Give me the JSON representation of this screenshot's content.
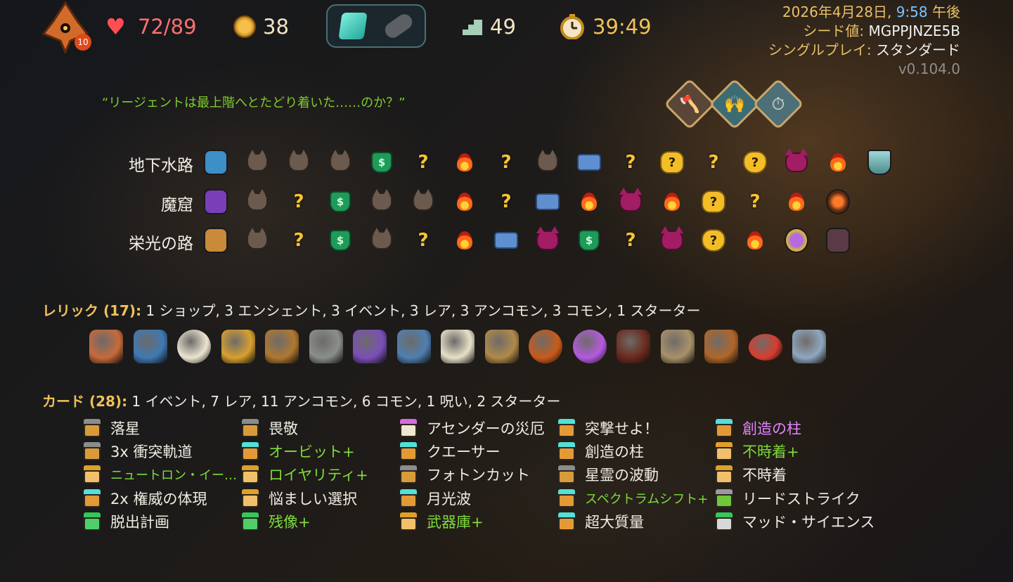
{
  "hud": {
    "hp": "72/89",
    "gold": "38",
    "floor": "49",
    "timer": "39:49",
    "ascension": "10"
  },
  "meta": {
    "date": "2026年4月28日, ",
    "time": "9:58",
    "ampm": " 午後",
    "seed_label": "シード値: ",
    "seed": "MGPPJNZE5B",
    "mode_label": "シングルプレイ: ",
    "mode": "スタンダード",
    "version": "v0.104.0"
  },
  "quote": "“リージェントは最上階へとたどり着いた……のか？”",
  "acts": [
    {
      "name": "地下水路",
      "nodes": [
        "boss-blue",
        "monster",
        "monster",
        "monster",
        "treasure-bag",
        "unknown",
        "rest",
        "unknown",
        "monster",
        "chest",
        "unknown",
        "rare-unknown",
        "unknown",
        "elite-unknown",
        "elite",
        "rest",
        "boss-end"
      ]
    },
    {
      "name": "魔窟",
      "nodes": [
        "boss-purple",
        "monster",
        "unknown",
        "treasure-bag",
        "monster",
        "monster",
        "rest",
        "unknown",
        "chest",
        "rest",
        "elite",
        "rest",
        "rare-unknown",
        "unknown",
        "rest",
        "boss-end2"
      ]
    },
    {
      "name": "栄光の路",
      "nodes": [
        "boss-lion",
        "monster",
        "unknown",
        "treasure-bag",
        "monster",
        "unknown",
        "rest",
        "chest",
        "elite",
        "treasure-bag",
        "unknown",
        "elite",
        "elite-unknown",
        "rest",
        "boss-gem",
        "boss-end3"
      ]
    }
  ],
  "relics": {
    "label": "レリック (17):",
    "summary": " 1 ショップ,  3 エンシェント,  3 イベント,  3 レア,  3 アンコモン,  3 コモン,  1 スターター",
    "items": [
      "ore-relic",
      "chest-relic",
      "cheese-relic",
      "flower-pot-relic",
      "horse-relic",
      "candelabra-relic",
      "tent-relic",
      "anvil-relic",
      "duck-relic",
      "lantern-relic",
      "yarn-relic",
      "orb-relic",
      "crossbow-relic",
      "backpack-relic",
      "crate-relic",
      "button-relic",
      "drill-relic"
    ]
  },
  "cards": {
    "label": "カード (28):",
    "summary": " 1 イベント,  7 レア,  11 アンコモン,  6 コモン,  1 呪い,  2 スターター",
    "columns": [
      [
        {
          "name": "落星",
          "icon": "gray",
          "color": "white"
        },
        {
          "name": "3x 衝突軌道",
          "icon": "gray",
          "color": "white"
        },
        {
          "name": "ニュートロン・イー…",
          "icon": "gold",
          "color": "green"
        },
        {
          "name": "2x 権威の体現",
          "icon": "teal",
          "color": "white"
        },
        {
          "name": "脱出計画",
          "icon": "green",
          "color": "white"
        }
      ],
      [
        {
          "name": "畏敬",
          "icon": "gray",
          "color": "white"
        },
        {
          "name": "オービット+",
          "icon": "teal",
          "color": "green"
        },
        {
          "name": "ロイヤリティ+",
          "icon": "gold",
          "color": "green"
        },
        {
          "name": "悩ましい選択",
          "icon": "gold",
          "color": "white"
        },
        {
          "name": "残像+",
          "icon": "green",
          "color": "green"
        }
      ],
      [
        {
          "name": "アセンダーの災厄",
          "icon": "pink",
          "color": "white"
        },
        {
          "name": "クエーサー",
          "icon": "teal",
          "color": "white"
        },
        {
          "name": "フォトンカット",
          "icon": "gray",
          "color": "white"
        },
        {
          "name": "月光波",
          "icon": "teal",
          "color": "white"
        },
        {
          "name": "武器庫+",
          "icon": "gold",
          "color": "green"
        }
      ],
      [
        {
          "name": "突撃せよ！",
          "icon": "teal",
          "color": "white"
        },
        {
          "name": "創造の柱",
          "icon": "teal",
          "color": "white"
        },
        {
          "name": "星霊の波動",
          "icon": "gray",
          "color": "white"
        },
        {
          "name": "スペクトラムシフト+",
          "icon": "teal",
          "color": "green"
        },
        {
          "name": "超大質量",
          "icon": "teal",
          "color": "white"
        }
      ],
      [
        {
          "name": "創造の柱",
          "icon": "teal",
          "color": "purple"
        },
        {
          "name": "不時着+",
          "icon": "gold",
          "color": "green"
        },
        {
          "name": "不時着",
          "icon": "gold",
          "color": "white"
        },
        {
          "name": "リードストライク",
          "icon": "gray-green",
          "color": "white"
        },
        {
          "name": "マッド・サイエンス",
          "icon": "green-gray",
          "color": "white"
        }
      ]
    ]
  },
  "colors": {
    "accent_gold": "#f0c158",
    "quote_green": "#7ecc2c",
    "hp_red": "#ff7070",
    "upgraded_green": "#7fdc3a"
  }
}
